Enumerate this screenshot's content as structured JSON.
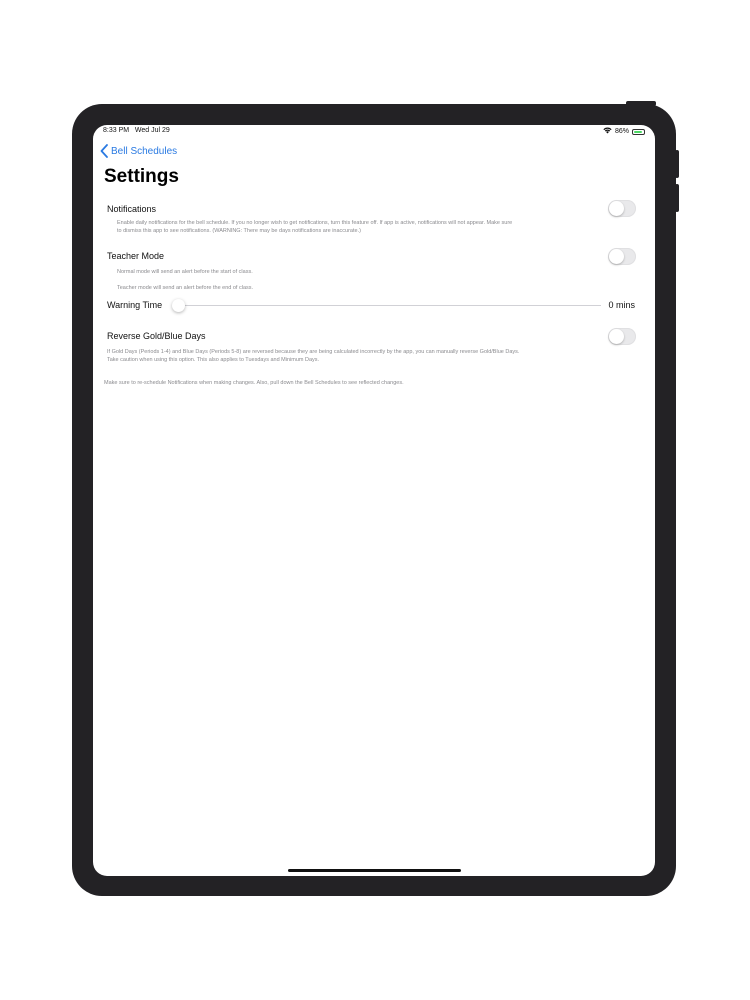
{
  "status_bar": {
    "time": "8:33 PM",
    "date": "Wed Jul 29",
    "battery": "86%",
    "battery_level": 0.86,
    "wifi_icon": "wifi-icon",
    "battery_color": "#4cd964"
  },
  "nav": {
    "back_label": "Bell Schedules",
    "back_icon": "chevron-left-icon",
    "title": "Settings",
    "accent_color": "#2a7ae2"
  },
  "settings": {
    "notifications": {
      "label": "Notifications",
      "enabled": false,
      "description_line1": "Enable daily notifications for the bell schedule. If you no longer wish to get notifications, turn this feature off. If app is active, notifications will not appear. Make sure",
      "description_line2": "to dismiss this app to see notifications. (WARNING: There may be days notifications are inaccurate.)"
    },
    "teacher_mode": {
      "label": "Teacher Mode",
      "enabled": false,
      "description_normal": "Normal mode will send an alert before the start of class.",
      "description_teacher": "Teacher mode will send an alert before the end of class."
    },
    "warning_time": {
      "label": "Warning Time",
      "value": 0,
      "value_label": "0 mins"
    },
    "reverse_days": {
      "label": "Reverse Gold/Blue Days",
      "enabled": false,
      "description_line1": "If Gold Days (Periods 1-4) and Blue Days (Periods 5-8) are reversed because they are being calculated incorrectly by the app, you can manually reverse Gold/Blue Days.",
      "description_line2": "Take caution when using this option. This also applies to Tuesdays and Minimum Days."
    },
    "footer_note": "Make sure to re-schedule Notifications when making changes. Also, pull down the Bell Schedules to see reflected changes."
  }
}
